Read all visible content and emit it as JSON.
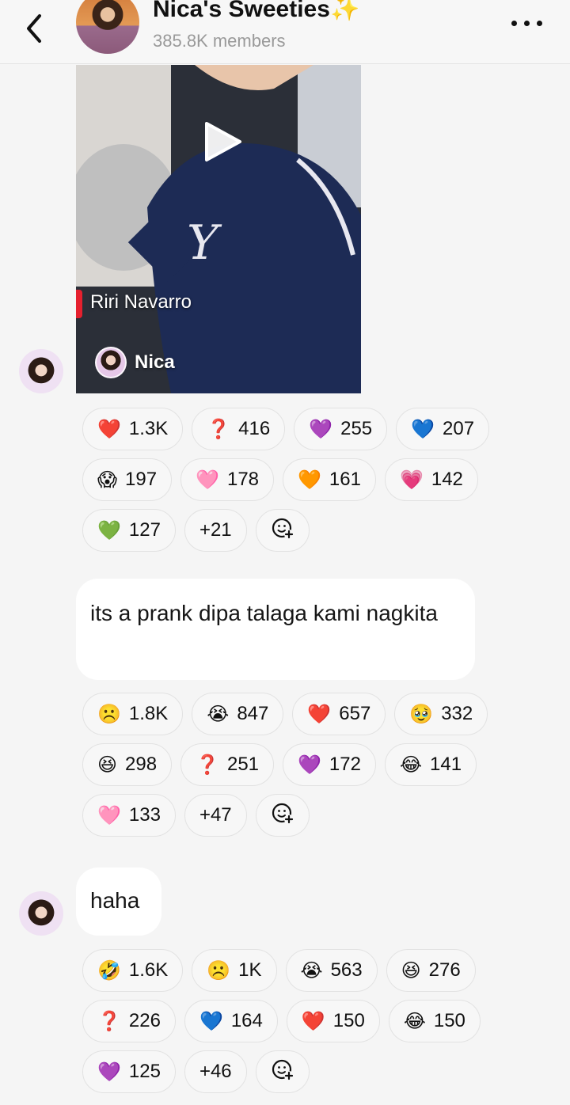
{
  "header": {
    "title": "Nica's Sweeties",
    "title_emoji": "✨",
    "members": "385.8K members"
  },
  "messages": [
    {
      "type": "video",
      "caption": "Riri Navarro",
      "author": "Nica",
      "reactions": [
        [
          {
            "icon": "red-heart",
            "emoji": "❤️",
            "count": "1.3K"
          },
          {
            "icon": "question-mark",
            "emoji": "❓",
            "count": "416"
          },
          {
            "icon": "purple-heart",
            "emoji": "💜",
            "count": "255"
          },
          {
            "icon": "blue-heart",
            "emoji": "💙",
            "count": "207"
          }
        ],
        [
          {
            "icon": "screaming-face",
            "emoji": "😱",
            "count": "197"
          },
          {
            "icon": "pink-heart",
            "emoji": "🩷",
            "count": "178"
          },
          {
            "icon": "orange-heart",
            "emoji": "🧡",
            "count": "161"
          },
          {
            "icon": "growing-heart",
            "emoji": "💗",
            "count": "142"
          }
        ],
        [
          {
            "icon": "green-heart",
            "emoji": "💚",
            "count": "127"
          },
          {
            "icon": "more",
            "emoji": "",
            "count": "+21"
          }
        ]
      ]
    },
    {
      "type": "text",
      "text": "its a prank dipa talaga kami nagkita",
      "reactions": [
        [
          {
            "icon": "frowning-face",
            "emoji": "☹️",
            "count": "1.8K"
          },
          {
            "icon": "crying-face",
            "emoji": "😭",
            "count": "847"
          },
          {
            "icon": "red-heart",
            "emoji": "❤️",
            "count": "657"
          },
          {
            "icon": "holding-back-tears",
            "emoji": "🥹",
            "count": "332"
          }
        ],
        [
          {
            "icon": "laughing-face",
            "emoji": "😆",
            "count": "298"
          },
          {
            "icon": "question-mark",
            "emoji": "❓",
            "count": "251"
          },
          {
            "icon": "purple-heart",
            "emoji": "💜",
            "count": "172"
          },
          {
            "icon": "tears-of-joy",
            "emoji": "😂",
            "count": "141"
          }
        ],
        [
          {
            "icon": "pink-heart",
            "emoji": "🩷",
            "count": "133"
          },
          {
            "icon": "more",
            "emoji": "",
            "count": "+47"
          }
        ]
      ]
    },
    {
      "type": "text",
      "text": "haha",
      "reactions": [
        [
          {
            "icon": "rolling-laughing",
            "emoji": "🤣",
            "count": "1.6K"
          },
          {
            "icon": "frowning-face",
            "emoji": "☹️",
            "count": "1K"
          },
          {
            "icon": "crying-face",
            "emoji": "😭",
            "count": "563"
          },
          {
            "icon": "laughing-face",
            "emoji": "😆",
            "count": "276"
          }
        ],
        [
          {
            "icon": "question-mark",
            "emoji": "❓",
            "count": "226"
          },
          {
            "icon": "blue-heart",
            "emoji": "💙",
            "count": "164"
          },
          {
            "icon": "red-heart",
            "emoji": "❤️",
            "count": "150"
          },
          {
            "icon": "tears-of-joy",
            "emoji": "😂",
            "count": "150"
          }
        ],
        [
          {
            "icon": "purple-heart",
            "emoji": "💜",
            "count": "125"
          },
          {
            "icon": "more",
            "emoji": "",
            "count": "+46"
          }
        ]
      ]
    }
  ],
  "colors": {
    "background": "#f5f5f5",
    "bubble": "#ffffff",
    "pill_border": "#e2e2e2",
    "muted_text": "#9a9a9a"
  }
}
